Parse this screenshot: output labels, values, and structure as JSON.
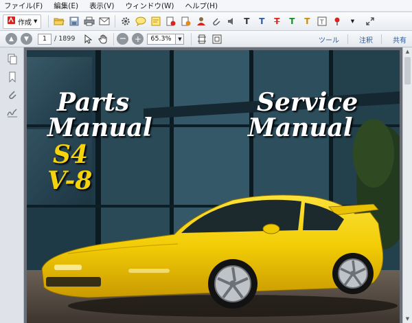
{
  "menu": {
    "items": [
      "ファイル(F)",
      "編集(E)",
      "表示(V)",
      "ウィンドウ(W)",
      "ヘルプ(H)"
    ]
  },
  "toolbar": {
    "create_label": "作成",
    "icons": [
      "open-folder-icon",
      "save-icon",
      "print-icon",
      "email-icon",
      "gear-icon",
      "comment-icon",
      "note-icon",
      "stamp-icon",
      "sign-icon",
      "attach-icon",
      "audio-icon",
      "text-insert-icon",
      "text-replace-icon",
      "strikethrough-icon",
      "highlight-icon",
      "text-box-icon",
      "textbox-icon",
      "pushpin-icon",
      "more-dropdown-icon",
      "expand-icon"
    ]
  },
  "nav": {
    "page_current": "1",
    "page_total": "/ 1899",
    "zoom": "65.3%",
    "tools_label": "ツール",
    "comment_label": "注釈",
    "share_label": "共有"
  },
  "cover": {
    "parts": "Parts",
    "manual_left": "Manual",
    "model": "S4",
    "engine": "V-8",
    "service": "Service",
    "manual_right": "Manual"
  },
  "colors": {
    "car_yellow": "#f2cc05",
    "title_yellow": "#f5d40c",
    "accent_blue": "#2c5a9e"
  }
}
